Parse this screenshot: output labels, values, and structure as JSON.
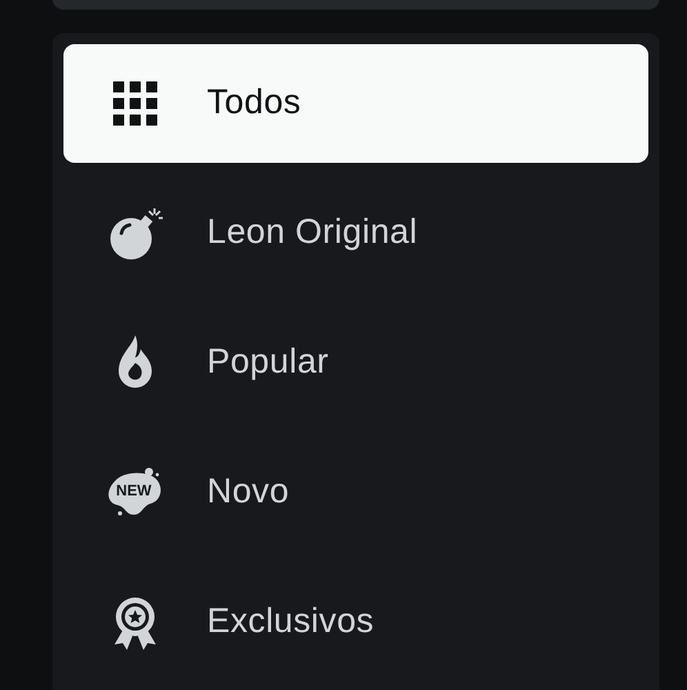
{
  "menu": {
    "items": [
      {
        "kind": "grid",
        "label": "Todos",
        "selected": true
      },
      {
        "kind": "bomb",
        "label": "Leon Original",
        "selected": false
      },
      {
        "kind": "flame",
        "label": "Popular",
        "selected": false
      },
      {
        "kind": "new",
        "label": "Novo",
        "selected": false,
        "icon_text": "NEW"
      },
      {
        "kind": "award",
        "label": "Exclusivos",
        "selected": false
      }
    ]
  }
}
